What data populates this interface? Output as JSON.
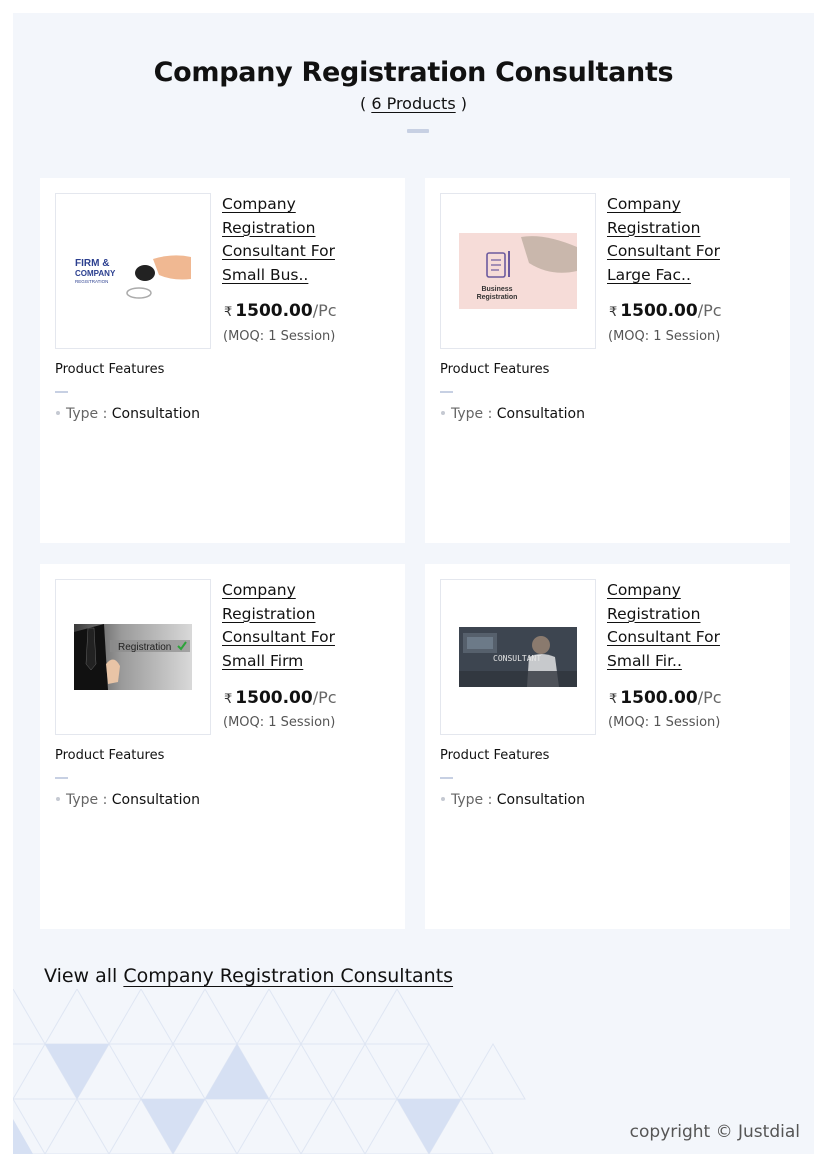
{
  "header": {
    "title": "Company Registration Consultants",
    "count_open": "( ",
    "count": "6 Products",
    "count_close": " )"
  },
  "products": [
    {
      "name": "Company Registration Consultant For Small Bus..",
      "currency": "₹",
      "price": "1500.00",
      "unit": "/Pc",
      "moq": "(MOQ: 1 Session)",
      "features_label": "Product Features",
      "feature_key": "Type : ",
      "feature_value": "Consultation",
      "image_text": [
        "FIRM &",
        "COMPANY",
        "REGISTRATION"
      ]
    },
    {
      "name": "Company Registration Consultant For Large Fac..",
      "currency": "₹",
      "price": "1500.00",
      "unit": "/Pc",
      "moq": "(MOQ: 1 Session)",
      "features_label": "Product Features",
      "feature_key": "Type : ",
      "feature_value": "Consultation",
      "image_text": [
        "Business",
        "Registration"
      ]
    },
    {
      "name": "Company Registration Consultant For Small Firm",
      "currency": "₹",
      "price": "1500.00",
      "unit": "/Pc",
      "moq": "(MOQ: 1 Session)",
      "features_label": "Product Features",
      "feature_key": "Type : ",
      "feature_value": "Consultation",
      "image_text": [
        "Registration"
      ]
    },
    {
      "name": "Company Registration Consultant For Small Fir..",
      "currency": "₹",
      "price": "1500.00",
      "unit": "/Pc",
      "moq": "(MOQ: 1 Session)",
      "features_label": "Product Features",
      "feature_key": "Type : ",
      "feature_value": "Consultation",
      "image_text": [
        "CONSULTANT"
      ]
    }
  ],
  "footer": {
    "view_all_prefix": "View all ",
    "view_all_link": "Company Registration Consultants",
    "copyright": "copyright © Justdial"
  },
  "colors": {
    "page_bg": "#f3f6fb",
    "card_bg": "#ffffff",
    "accent_bar": "#c7d0e3",
    "triangle_fill": "#d6e0f3"
  },
  "icons": [
    "rupee-icon",
    "bullet-dot-icon"
  ]
}
